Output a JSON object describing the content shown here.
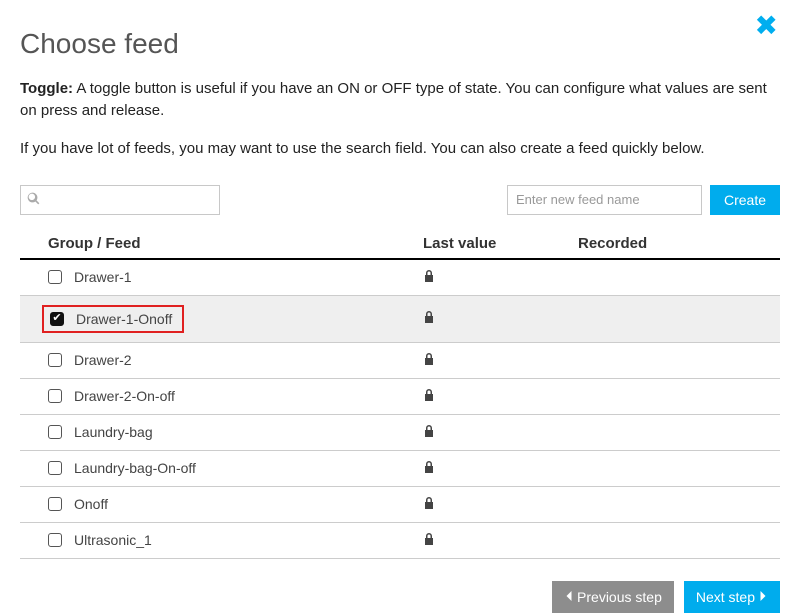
{
  "header": {
    "title": "Choose feed"
  },
  "description": {
    "label": "Toggle:",
    "text": "A toggle button is useful if you have an ON or OFF type of state. You can configure what values are sent on press and release."
  },
  "hint": "If you have lot of feeds, you may want to use the search field. You can also create a feed quickly below.",
  "search": {
    "value": ""
  },
  "create": {
    "placeholder": "Enter new feed name",
    "button": "Create",
    "value": ""
  },
  "table": {
    "cols": {
      "group": "Group / Feed",
      "last": "Last value",
      "recorded": "Recorded"
    },
    "rows": [
      {
        "name": "Drawer-1",
        "checked": false,
        "locked": true,
        "last": "",
        "recorded": "",
        "highlighted": false
      },
      {
        "name": "Drawer-1-Onoff",
        "checked": true,
        "locked": true,
        "last": "",
        "recorded": "",
        "highlighted": true
      },
      {
        "name": "Drawer-2",
        "checked": false,
        "locked": true,
        "last": "",
        "recorded": "",
        "highlighted": false
      },
      {
        "name": "Drawer-2-On-off",
        "checked": false,
        "locked": true,
        "last": "",
        "recorded": "",
        "highlighted": false
      },
      {
        "name": "Laundry-bag",
        "checked": false,
        "locked": true,
        "last": "",
        "recorded": "",
        "highlighted": false
      },
      {
        "name": "Laundry-bag-On-off",
        "checked": false,
        "locked": true,
        "last": "",
        "recorded": "",
        "highlighted": false
      },
      {
        "name": "Onoff",
        "checked": false,
        "locked": true,
        "last": "",
        "recorded": "",
        "highlighted": false
      },
      {
        "name": "Ultrasonic_1",
        "checked": false,
        "locked": true,
        "last": "",
        "recorded": "",
        "highlighted": false
      }
    ]
  },
  "footer": {
    "prev": "Previous step",
    "next": "Next step"
  }
}
